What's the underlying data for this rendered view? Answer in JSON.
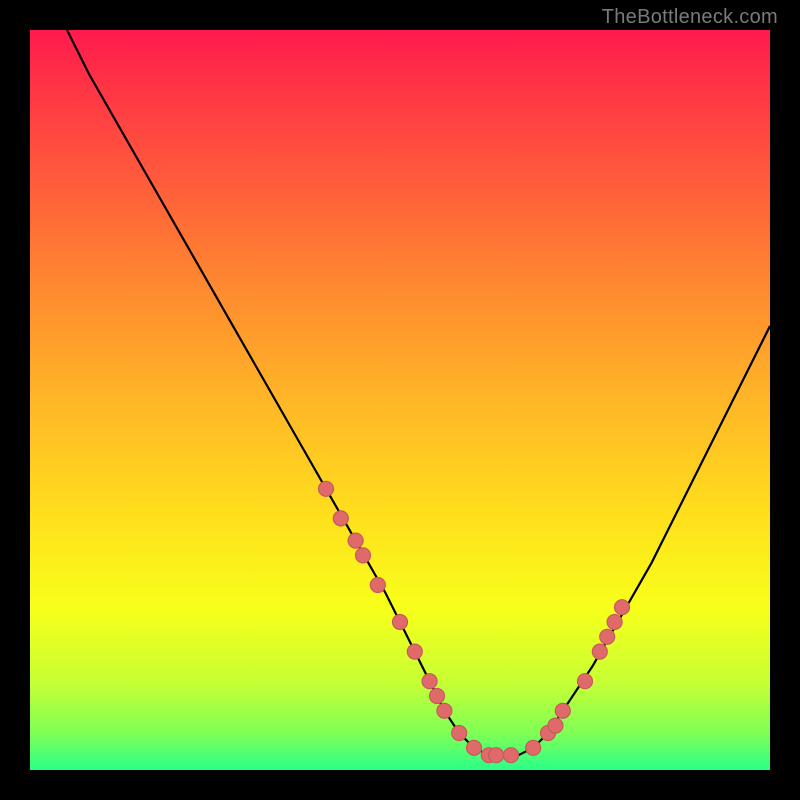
{
  "watermark": "TheBottleneck.com",
  "chart_data": {
    "type": "line",
    "title": "",
    "xlabel": "",
    "ylabel": "",
    "xlim": [
      0,
      100
    ],
    "ylim": [
      0,
      100
    ],
    "grid": false,
    "legend": false,
    "series": [
      {
        "name": "bottleneck-curve",
        "color": "#000000",
        "x": [
          5,
          8,
          12,
          16,
          20,
          24,
          28,
          32,
          36,
          40,
          44,
          48,
          50,
          52,
          54,
          56,
          58,
          60,
          62,
          64,
          66,
          68,
          70,
          72,
          76,
          80,
          84,
          88,
          92,
          96,
          100
        ],
        "y": [
          100,
          94,
          87,
          80,
          73,
          66,
          59,
          52,
          45,
          38,
          31,
          24,
          20,
          16,
          12,
          8,
          5,
          3,
          2,
          2,
          2,
          3,
          5,
          8,
          14,
          21,
          28,
          36,
          44,
          52,
          60
        ]
      }
    ],
    "markers": {
      "name": "curve-markers",
      "color": "#e06a6a",
      "radius": 7.5,
      "points": [
        {
          "x": 40,
          "y": 38
        },
        {
          "x": 42,
          "y": 34
        },
        {
          "x": 44,
          "y": 31
        },
        {
          "x": 45,
          "y": 29
        },
        {
          "x": 47,
          "y": 25
        },
        {
          "x": 50,
          "y": 20
        },
        {
          "x": 52,
          "y": 16
        },
        {
          "x": 54,
          "y": 12
        },
        {
          "x": 55,
          "y": 10
        },
        {
          "x": 56,
          "y": 8
        },
        {
          "x": 58,
          "y": 5
        },
        {
          "x": 60,
          "y": 3
        },
        {
          "x": 62,
          "y": 2
        },
        {
          "x": 63,
          "y": 2
        },
        {
          "x": 65,
          "y": 2
        },
        {
          "x": 68,
          "y": 3
        },
        {
          "x": 70,
          "y": 5
        },
        {
          "x": 71,
          "y": 6
        },
        {
          "x": 72,
          "y": 8
        },
        {
          "x": 75,
          "y": 12
        },
        {
          "x": 77,
          "y": 16
        },
        {
          "x": 78,
          "y": 18
        },
        {
          "x": 79,
          "y": 20
        },
        {
          "x": 80,
          "y": 22
        }
      ]
    }
  }
}
